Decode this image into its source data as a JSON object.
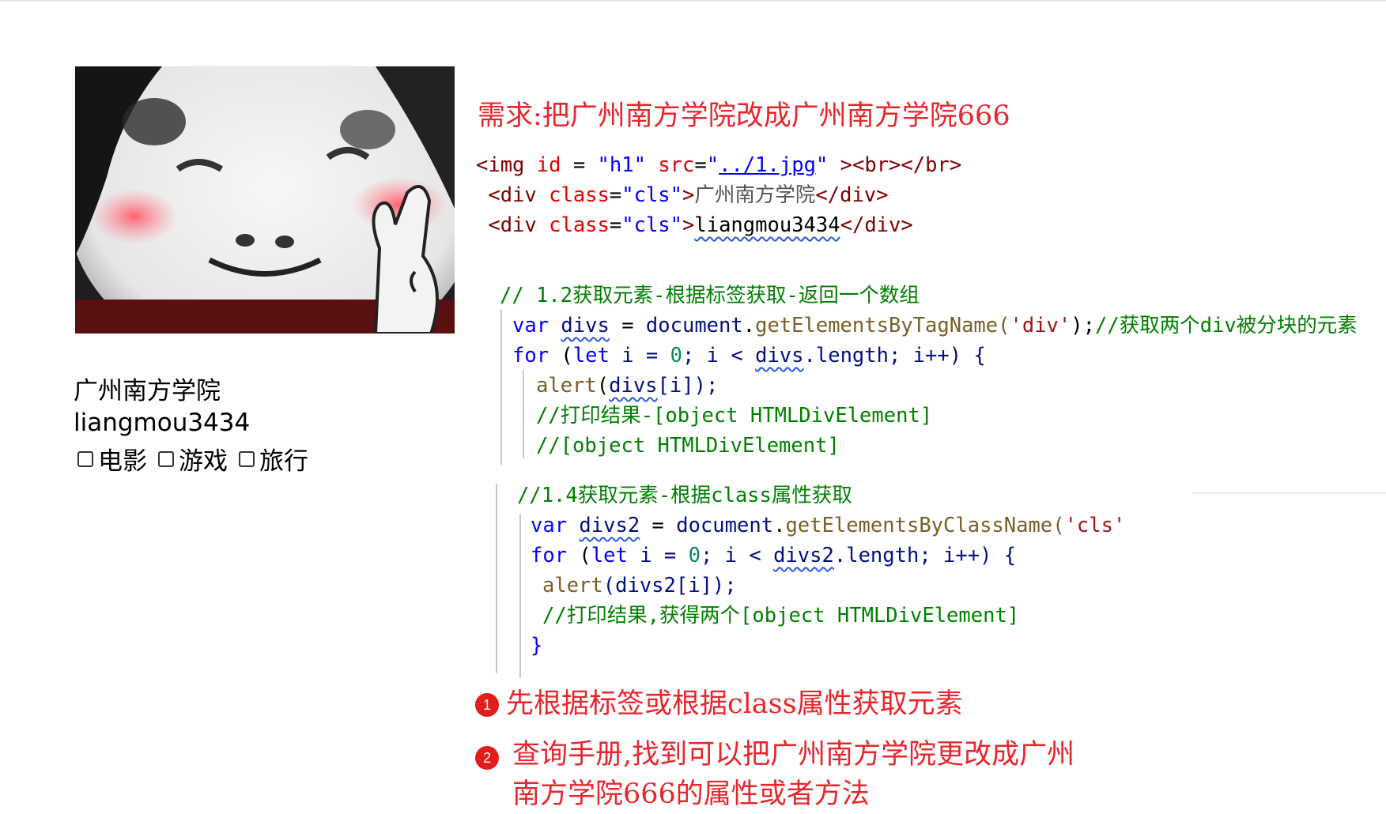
{
  "rendered_page": {
    "text_line_1": "广州南方学院",
    "text_line_2": "liangmou3434",
    "checkboxes": [
      {
        "label": "电影",
        "checked": false
      },
      {
        "label": "游戏",
        "checked": false
      },
      {
        "label": "旅行",
        "checked": false
      }
    ]
  },
  "requirement": "需求:把广州南方学院改成广州南方学院666",
  "html_code": {
    "line1": {
      "open": "<img ",
      "attr_id": "id",
      "eq1": " = ",
      "val_id": "\"h1\"",
      "attr_src": " src",
      "eq2": "=",
      "q1": "\"",
      "src_link": "../1.jpg",
      "q2": "\"",
      "tail": " ><br></br>"
    },
    "line2": {
      "open": " <div ",
      "attr": "class",
      "eq": "=",
      "val": "\"cls\"",
      "gt": ">",
      "text": "广州南方学院",
      "close": "</div>"
    },
    "line3": {
      "open": " <div ",
      "attr": "class",
      "eq": "=",
      "val": "\"cls\"",
      "gt": ">",
      "text": "liangmou3434",
      "close": "</div>"
    }
  },
  "js_block_1": {
    "comment": "// 1.2获取元素-根据标签获取-返回一个数组",
    "decl_kw": "var",
    "decl_var": "divs",
    "decl_eq": " = ",
    "decl_obj": "document",
    "decl_dot": ".",
    "decl_fn": "getElementsByTagName",
    "decl_p1": "(",
    "decl_str": "'div'",
    "decl_p2": ");",
    "decl_cmt": "//获取两个div被分块的元素",
    "for_kw": "for",
    "for_open": " (",
    "let_kw": "let",
    "for_i": " i = ",
    "for_zero": "0",
    "for_mid": "; i < ",
    "for_var": "divs",
    "for_rest": ".length; i++) {",
    "alert_fn": "alert",
    "alert_p": "(",
    "alert_var": "divs",
    "alert_rest": "[i]);",
    "cmt1": "//打印结果-[object HTMLDivElement]",
    "cmt2": "//[object HTMLDivElement]"
  },
  "js_block_2": {
    "comment": "//1.4获取元素-根据class属性获取",
    "decl_kw": "var",
    "decl_var": "divs2",
    "decl_eq": " = ",
    "decl_obj": "document",
    "decl_dot": ".",
    "decl_fn": "getElementsByClassName",
    "decl_p1": "(",
    "decl_str": "'cls'",
    "for_kw": "for",
    "for_open": " (",
    "let_kw": "let",
    "for_i": " i = ",
    "for_zero": "0",
    "for_mid": "; i < ",
    "for_var": "divs2",
    "for_rest": ".length; i++) {",
    "alert_fn": "alert",
    "alert_rest": "(divs2[i]);",
    "cmt1": "//打印结果,获得两个[object HTMLDivElement]",
    "close_brace": "}"
  },
  "notes": [
    {
      "badge": "1",
      "text": "先根据标签或根据class属性获取元素"
    },
    {
      "badge": "2",
      "line1": "查询手册,找到可以把广州南方学院更改成广州",
      "line2": "南方学院666的属性或者方法"
    }
  ],
  "colors": {
    "annotation_red": "#e8262b",
    "comment_green": "#008000",
    "keyword_blue": "#0000ff",
    "tag_maroon": "#800000"
  }
}
